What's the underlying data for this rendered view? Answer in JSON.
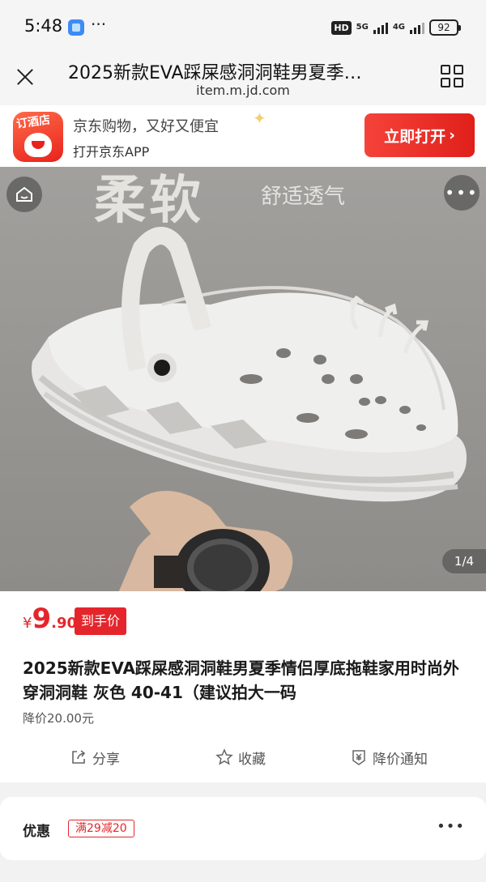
{
  "status_bar": {
    "time": "5:48",
    "dots": "···",
    "hd": "HD",
    "net1": "5G",
    "net2": "4G",
    "battery": "92"
  },
  "browser": {
    "title": "2025新款EVA踩屎感洞洞鞋男夏季…",
    "url": "item.m.jd.com"
  },
  "app_banner": {
    "logo_text": "订酒店",
    "line1": "京东购物，又好又便宜",
    "line2": "打开京东APP",
    "button_label": "立即打开",
    "button_arrow": "›"
  },
  "product_image": {
    "headline": "柔软",
    "headline_sub": "舒适透气",
    "counter": "1/4"
  },
  "price": {
    "currency": "¥",
    "integer": "9",
    "decimal": ".90",
    "tag": "到手价"
  },
  "product": {
    "title": "2025新款EVA踩屎感洞洞鞋男夏季情侣厚底拖鞋家用时尚外穿洞洞鞋 灰色 40-41（建议拍大一码",
    "price_drop": "降价20.00元"
  },
  "actions": {
    "share": "分享",
    "favorite": "收藏",
    "price_alert": "降价通知"
  },
  "promo": {
    "label": "优惠",
    "coupon": "满29减20",
    "more": "•••"
  },
  "colors": {
    "accent_red": "#e4262c",
    "banner_button": "#e0201a"
  }
}
